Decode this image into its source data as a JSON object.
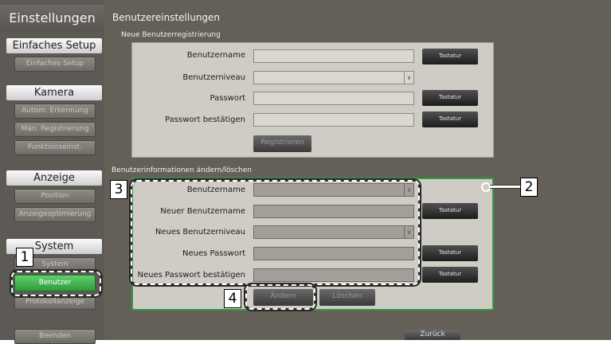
{
  "sidebar": {
    "title": "Einstellungen",
    "sections": [
      {
        "head": "Einfaches Setup",
        "items": [
          "Einfaches Setup"
        ]
      },
      {
        "head": "Kamera",
        "items": [
          "Autom. Erkennung",
          "Man. Registrierung",
          "Funktionseinst."
        ]
      },
      {
        "head": "Anzeige",
        "items": [
          "Position",
          "Anzeigeoptimierung"
        ]
      },
      {
        "head": "System",
        "items": [
          "System",
          "Benutzer",
          "Protokollanzeige"
        ]
      }
    ],
    "exit_label": "Beenden"
  },
  "main": {
    "title": "Benutzereinstellungen",
    "new_section": {
      "header": "Neue Benutzerregistrierung",
      "labels": [
        "Benutzername",
        "Benutzerniveau",
        "Passwort",
        "Passwort bestätigen"
      ],
      "keyboard_label": "Tastatur",
      "register_label": "Registrieren"
    },
    "edit_section": {
      "header": "Benutzerinformationen ändern/löschen",
      "labels": [
        "Benutzername",
        "Neuer Benutzername",
        "Neues Benutzerniveau",
        "Neues Passwort",
        "Neues Passwort bestätigen"
      ],
      "keyboard_label": "Tastatur",
      "change_label": "Ändern",
      "delete_label": "Löschen"
    },
    "back_label": "Zurück",
    "dropdown_glyph": "∨"
  },
  "callouts": [
    "1",
    "2",
    "3",
    "4"
  ],
  "colors": {
    "highlight": "#2e9b3c",
    "panel": "#cfccc5",
    "background": "#646058"
  }
}
